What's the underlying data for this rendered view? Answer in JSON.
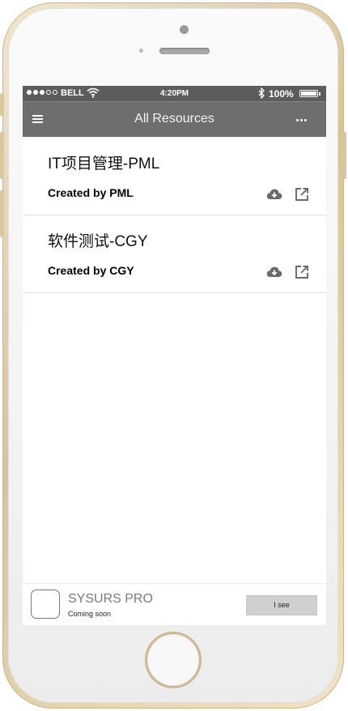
{
  "status_bar": {
    "signal_full": 3,
    "signal_total": 5,
    "carrier": "BELL",
    "time": "4:20PM",
    "battery": "100%"
  },
  "nav": {
    "title": "All Resources",
    "menu_icon": "hamburger-menu-icon",
    "more_icon": "more-dots-icon"
  },
  "resources": [
    {
      "title": "IT项目管理-PML",
      "creator": "Created by PML"
    },
    {
      "title": "软件测试-CGY",
      "creator": "Created by CGY"
    }
  ],
  "banner": {
    "app_name": "SYSURS PRO",
    "subtitle": "Coming soon",
    "button_label": "I see"
  },
  "colors": {
    "status_bar_bg": "#5c5c5c",
    "nav_bg": "#6e6e6e",
    "icon_gray": "#6a6a6a",
    "button_bg": "#d0d0d0"
  }
}
